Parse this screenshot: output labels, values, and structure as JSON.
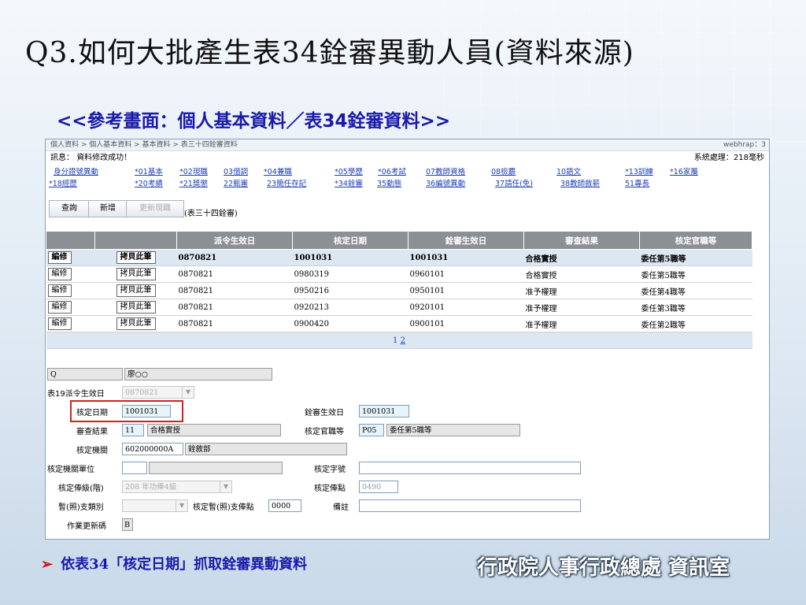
{
  "slide": {
    "title": "Q3.如何大批產生表34銓審異動人員(資料來源)",
    "subtitle": "<<參考畫面：個人基本資料／表34銓審資料>>",
    "note": "依表34「核定日期」抓取銓審異動資料",
    "note_bullet": "➢",
    "org": "行政院人事行政總處 資訊室"
  },
  "app": {
    "breadcrumb": "個人資料 > 個人基本資料 > 基本資料 > 表三十四銓審資料",
    "user": "webhrap：3",
    "message_label": "訊息：",
    "message": "資料修改成功！",
    "sys_time": "系統處理：218毫秒",
    "nav_row1": [
      "身分證號異動",
      "*01基本",
      "*02現職",
      "03借調",
      "*04兼職",
      "*05學歷",
      "*06考試",
      "07教師資格",
      "08檢覈",
      "10語文",
      "*13訓練",
      "*16家屬"
    ],
    "nav_row2": [
      "*18經歷",
      "*20考績",
      "*21獎懲",
      "22甄審",
      "23簡任存記",
      "*34銓審",
      "35動態",
      "36編號異動",
      "37請任(免)",
      "38教師敘薪",
      "51專長"
    ],
    "buttons": {
      "query": "查詢",
      "add": "新增",
      "renew": "更新現職"
    },
    "table_caption": "(表三十四銓審)",
    "headers": [
      "派令生效日",
      "核定日期",
      "銓審生效日",
      "審查結果",
      "核定官職等"
    ],
    "row_edit": "編修",
    "row_copy": "拷貝此筆",
    "rows": [
      [
        "0870821",
        "1001031",
        "1001031",
        "合格實授",
        "委任第5職等"
      ],
      [
        "0870821",
        "0980319",
        "0960101",
        "合格實授",
        "委任第5職等"
      ],
      [
        "0870821",
        "0950216",
        "0950101",
        "准予權理",
        "委任第4職等"
      ],
      [
        "0870821",
        "0920213",
        "0920101",
        "准予權理",
        "委任第3職等"
      ],
      [
        "0870821",
        "0900420",
        "0900101",
        "准予權理",
        "委任第2職等"
      ]
    ],
    "pager": [
      "1",
      "2"
    ]
  },
  "form": {
    "id_value": "Q",
    "name_value": "廖○○",
    "l_t19": "表19派令生效日",
    "t19_value": "0870821",
    "l_approve_date": "核定日期",
    "approve_date": "1001031",
    "l_review_date": "銓審生效日",
    "review_date": "1001031",
    "l_result": "審查結果",
    "result_code": "11",
    "result_text": "合格實授",
    "l_grade": "核定官職等",
    "grade_code": "P05",
    "grade_text": "委任第5職等",
    "l_org": "核定機關",
    "org_code": "602000000A",
    "org_name": "銓敘部",
    "l_unit": "核定機關單位",
    "unit_code": "",
    "unit_name": "",
    "l_docno": "核定字號",
    "docno": "",
    "l_level": "核定俸級(階)",
    "level_value": "208 年功俸4級",
    "l_points": "核定俸點",
    "points_value": "0490",
    "l_temp_type": "暫(照)支類別",
    "temp_type": "",
    "l_temp_points": "核定暫(照)支俸點",
    "temp_points": "0000",
    "l_remark": "備註",
    "remark": "",
    "l_update_code": "作業更新碼",
    "update_code": "B"
  }
}
